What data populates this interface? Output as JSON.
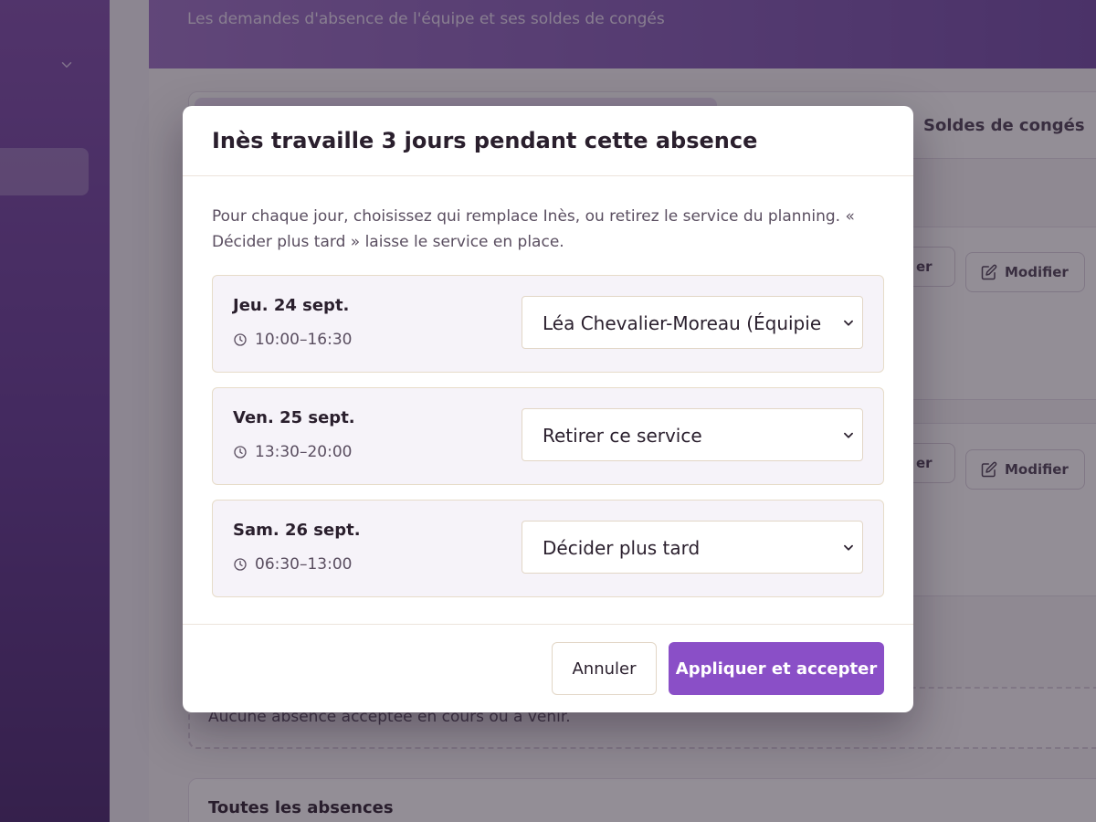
{
  "header": {
    "subtitle": "Les demandes d'absence de l'équipe et ses soldes de congés"
  },
  "tabs": {
    "soldes_label": "Soldes de congés"
  },
  "requests": [
    {
      "secondary_label": "er",
      "edit_label": "Modifier"
    },
    {
      "secondary_label": "er",
      "edit_label": "Modifier"
    }
  ],
  "empty_state": "Aucune absence acceptée en cours ou à venir.",
  "all_absences_title": "Toutes les absences",
  "modal": {
    "title": "Inès travaille 3 jours pendant cette absence",
    "intro": "Pour chaque jour, choisissez qui remplace Inès, ou retirez le service du planning. « Décider plus tard » laisse le service en place.",
    "days": [
      {
        "label": "Jeu. 24 sept.",
        "time": "10:00–16:30",
        "selection": "Léa Chevalier-Moreau (Équipie"
      },
      {
        "label": "Ven. 25 sept.",
        "time": "13:30–20:00",
        "selection": "Retirer ce service"
      },
      {
        "label": "Sam. 26 sept.",
        "time": "06:30–13:00",
        "selection": "Décider plus tard"
      }
    ],
    "cancel_label": "Annuler",
    "apply_label": "Appliquer et accepter"
  },
  "colors": {
    "accent": "#8a4fc7",
    "sidebar": "#5e3590",
    "header": "#8057b3"
  },
  "icons": {
    "sidebar_chevron": "chevron-down-icon",
    "edit": "edit-icon",
    "time": "clock-icon",
    "select_arrow": "chevron-down-icon"
  }
}
